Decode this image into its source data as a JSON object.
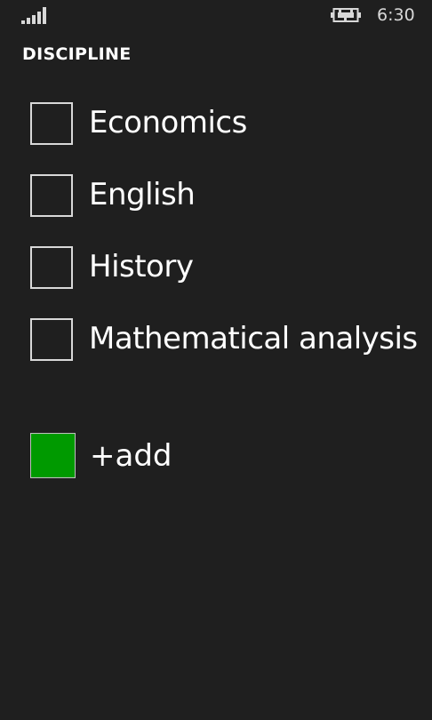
{
  "status_bar": {
    "signal_icon": "signal-strength-icon",
    "battery_icon": "battery-charging-icon",
    "time": "6:30"
  },
  "page": {
    "title": "DISCIPLINE"
  },
  "disciplines": [
    {
      "label": "Economics",
      "checked": false
    },
    {
      "label": "English",
      "checked": false
    },
    {
      "label": "History",
      "checked": false
    },
    {
      "label": "Mathematical analysis",
      "checked": false
    }
  ],
  "add": {
    "label": "+add",
    "color": "#009a00"
  }
}
